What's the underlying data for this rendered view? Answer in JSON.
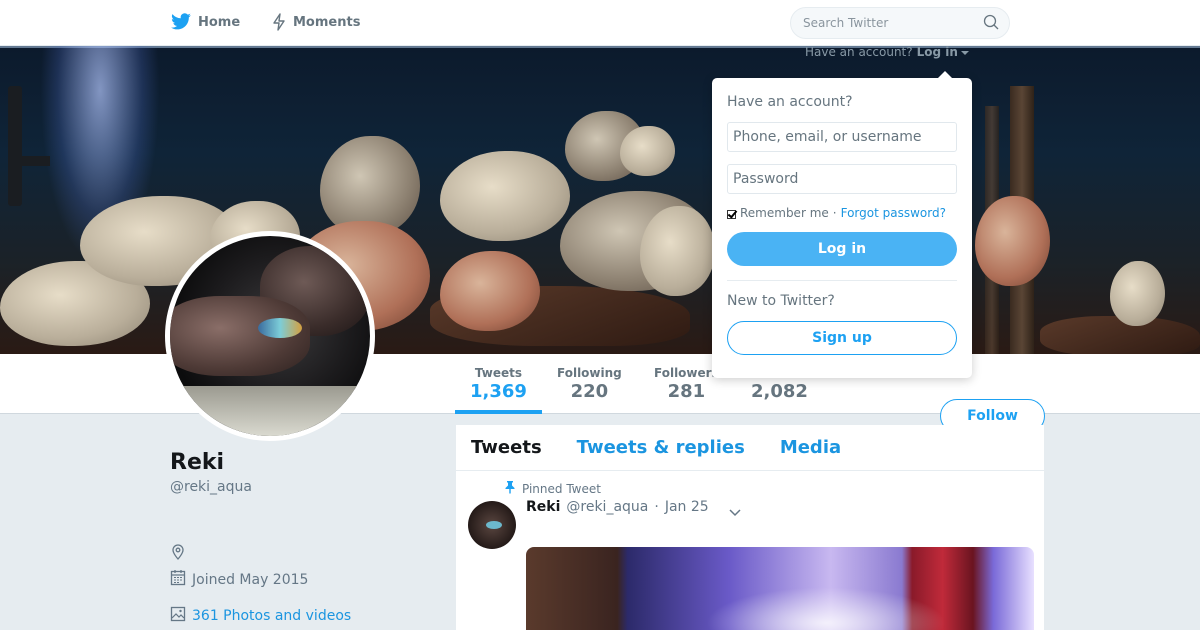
{
  "nav": {
    "home_label": "Home",
    "moments_label": "Moments",
    "search_placeholder": "Search Twitter"
  },
  "header": {
    "have_account_text": "Have an account?",
    "login_label": "Log in"
  },
  "login_dropdown": {
    "title": "Have an account?",
    "username_placeholder": "Phone, email, or username",
    "password_placeholder": "Password",
    "remember_me_label": "Remember me",
    "separator": "·",
    "forgot_password_label": "Forgot password?",
    "login_button": "Log in",
    "new_to_twitter": "New to Twitter?",
    "signup_button": "Sign up"
  },
  "stats": {
    "tweets_label": "Tweets",
    "tweets_value": "1,369",
    "following_label": "Following",
    "following_value": "220",
    "followers_label": "Followers",
    "followers_value": "281",
    "likes_value": "2,082"
  },
  "follow_button": "Follow",
  "profile": {
    "name": "Reki",
    "handle": "@reki_aqua",
    "joined": "Joined May 2015",
    "photos_videos": "361 Photos and videos"
  },
  "tabs": [
    "Tweets",
    "Tweets & replies",
    "Media"
  ],
  "pinned_tweet": {
    "pinned_label": "Pinned Tweet",
    "name": "Reki",
    "handle": "@reki_aqua",
    "separator": "·",
    "date": "Jan 25"
  },
  "colors": {
    "accent": "#1da1f2",
    "link": "#1b95e0",
    "login_button": "#4ab3f4"
  }
}
